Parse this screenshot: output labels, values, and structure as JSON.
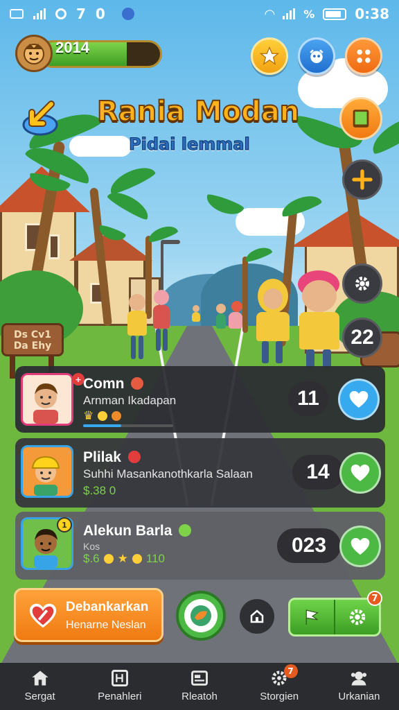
{
  "status_bar": {
    "left_glyphs": [
      "7",
      "0"
    ],
    "time": "0:38",
    "signal_text": "%"
  },
  "hud": {
    "player_score": "2014",
    "xp_fraction": 0.72
  },
  "title": {
    "main": "Rania Modan",
    "sub": "Pidai lemmal"
  },
  "side_buttons": {
    "counter": "22"
  },
  "cards": [
    {
      "name": "Comn",
      "subtitle": "Arnman Ikadapan",
      "meta": "",
      "count": "11",
      "heart_color": "#36a9ef",
      "progress": 0.42
    },
    {
      "name": "Plilak",
      "subtitle": "Suhhi Masankanothkarla Salaan",
      "meta": "$.38 0",
      "count": "14",
      "heart_color": "#4cb944"
    },
    {
      "name": "Alekun Barla",
      "subtitle": "Kos",
      "meta": "$.6",
      "meta_tail": "110",
      "count": "023",
      "heart_color": "#4cb944"
    }
  ],
  "actions": {
    "cta_title": "Debankarkan",
    "cta_sub": "Henarne Neslan",
    "notif_count": "7"
  },
  "bottom_nav": [
    {
      "label": "Sergat",
      "icon": "home-icon"
    },
    {
      "label": "Penahleri",
      "icon": "cards-icon"
    },
    {
      "label": "Rleatoh",
      "icon": "tv-icon"
    },
    {
      "label": "Storgien",
      "icon": "gear-icon",
      "badge": "7"
    },
    {
      "label": "Urkanian",
      "icon": "people-icon"
    }
  ]
}
